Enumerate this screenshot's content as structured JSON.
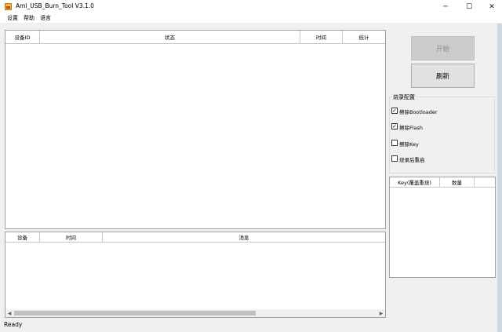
{
  "window": {
    "title": "Aml_USB_Burn_Tool V3.1.0",
    "controls": {
      "minimize": "─",
      "maximize": "☐",
      "close": "✕"
    }
  },
  "menu": [
    "设置",
    "帮助",
    "语言"
  ],
  "device_table": {
    "columns": [
      "设备ID",
      "状态",
      "时间",
      "统计"
    ],
    "rows": []
  },
  "log_table": {
    "columns": [
      "设备",
      "时间",
      "消息"
    ],
    "rows": []
  },
  "buttons": {
    "start": "开始",
    "refresh": "刷新"
  },
  "burn_config": {
    "label": "烧录配置",
    "options": [
      {
        "label": "擦除Bootloader",
        "checked": true
      },
      {
        "label": "擦除Flash",
        "checked": true
      },
      {
        "label": "擦除Key",
        "checked": false
      },
      {
        "label": "烧录后重启",
        "checked": false
      }
    ]
  },
  "key_table": {
    "columns": [
      "Key(覆盖重烧)",
      "数量"
    ]
  },
  "status_bar": {
    "text": "Ready"
  },
  "checkmark": "✓",
  "icons": {
    "app": "burn-tool-icon",
    "scroll_left": "◀",
    "scroll_right": "▶"
  }
}
